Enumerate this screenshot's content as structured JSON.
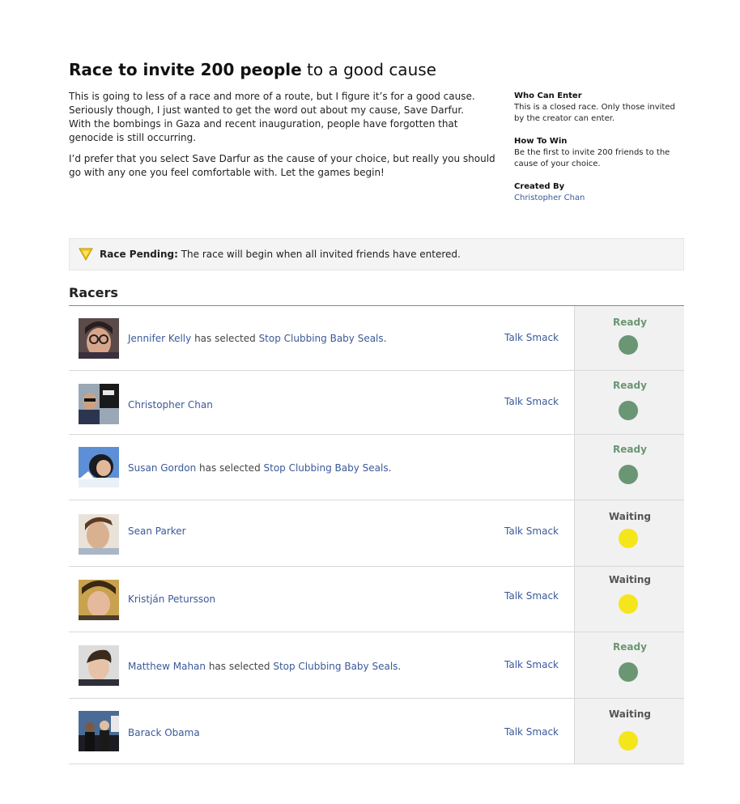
{
  "title": {
    "bold": "Race to invite 200 people",
    "rest": " to a good cause"
  },
  "description": {
    "p1": [
      "This is going to less of a race and more of a route, but I figure it’s for a good cause.",
      "Seriously though, I just wanted to get the word out about my cause, Save Darfur.",
      "With the bombings in Gaza and recent inauguration, people have forgotten that genocide is still occurring."
    ],
    "p2": "I’d prefer that you select Save Darfur as the cause of your choice, but really you should go with any one you feel comfortable with. Let the games begin!"
  },
  "info": {
    "who_heading": "Who Can Enter",
    "who_text": "This is a closed race. Only those invited by the creator can enter.",
    "how_heading": "How To Win",
    "how_text": "Be the first to invite 200 friends to the cause of your choice.",
    "created_heading": "Created By",
    "created_by": "Christopher Chan"
  },
  "pending": {
    "label": "Race Pending:",
    "text": " The race will begin when all invited friends have entered."
  },
  "racers_title": "Racers",
  "colors": {
    "link": "#3b5998",
    "ready": "#6a9673",
    "waiting": "#f5e61c",
    "waiting_label": "#555555"
  },
  "racers": [
    {
      "name": "Jennifer Kelly",
      "selected_text": " has selected ",
      "cause": "Stop Clubbing Baby Seals",
      "period": ".",
      "talk_smack": "Talk Smack",
      "status": "Ready",
      "avatar": "avatar-woman-glasses"
    },
    {
      "name": "Christopher Chan",
      "selected_text": "",
      "cause": "",
      "period": "",
      "talk_smack": "Talk Smack",
      "status": "Ready",
      "avatar": "avatar-man-sunglasses"
    },
    {
      "name": "Susan Gordon",
      "selected_text": " has selected ",
      "cause": "Stop Clubbing Baby Seals",
      "period": ".",
      "talk_smack": "",
      "status": "Ready",
      "avatar": "avatar-woman-ski"
    },
    {
      "name": "Sean Parker",
      "selected_text": "",
      "cause": "",
      "period": "",
      "talk_smack": "Talk Smack",
      "status": "Waiting",
      "avatar": "avatar-man-profile"
    },
    {
      "name": "Kristján Petursson",
      "selected_text": "",
      "cause": "",
      "period": "",
      "talk_smack": "Talk Smack",
      "status": "Waiting",
      "avatar": "avatar-man-hat"
    },
    {
      "name": "Matthew Mahan",
      "selected_text": " has selected ",
      "cause": "Stop Clubbing Baby Seals",
      "period": ".",
      "talk_smack": "Talk Smack",
      "status": "Ready",
      "avatar": "avatar-man-portrait"
    },
    {
      "name": "Barack Obama",
      "selected_text": "",
      "cause": "",
      "period": "",
      "talk_smack": "Talk Smack",
      "status": "Waiting",
      "avatar": "avatar-group-suits"
    }
  ]
}
